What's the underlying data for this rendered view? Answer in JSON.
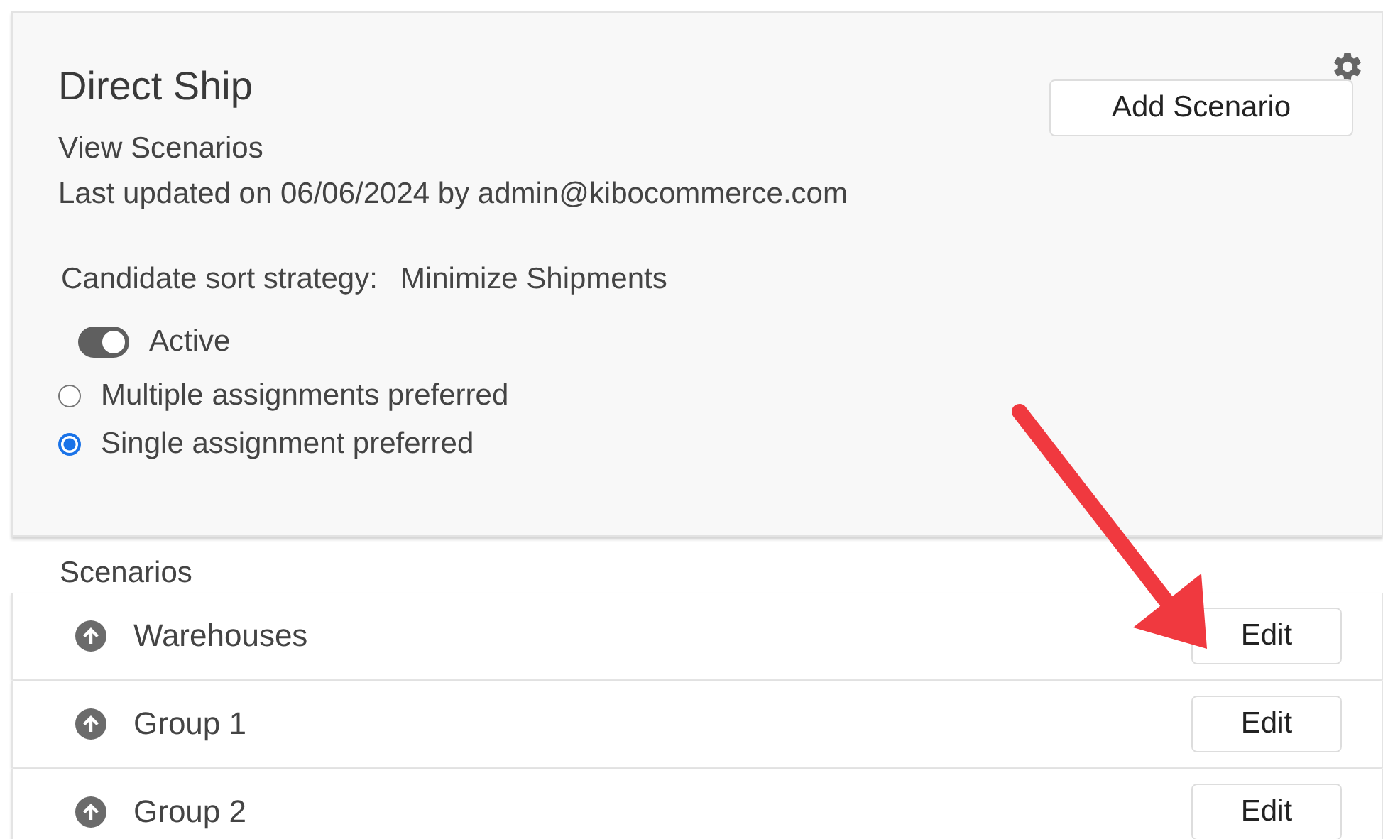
{
  "panel": {
    "title": "Direct Ship",
    "subtitle": "View Scenarios",
    "last_updated": "Last updated on 06/06/2024 by admin@kibocommerce.com",
    "add_button": "Add Scenario",
    "sort_strategy": {
      "label": "Candidate sort strategy:",
      "value": "Minimize Shipments"
    },
    "active_toggle": {
      "label": "Active",
      "on": true
    },
    "assignment_options": [
      {
        "label": "Multiple assignments preferred",
        "selected": false
      },
      {
        "label": "Single assignment preferred",
        "selected": true
      }
    ]
  },
  "scenarios": {
    "heading": "Scenarios",
    "items": [
      {
        "name": "Warehouses",
        "button": "Edit"
      },
      {
        "name": "Group 1",
        "button": "Edit"
      },
      {
        "name": "Group 2",
        "button": "Edit"
      }
    ]
  }
}
